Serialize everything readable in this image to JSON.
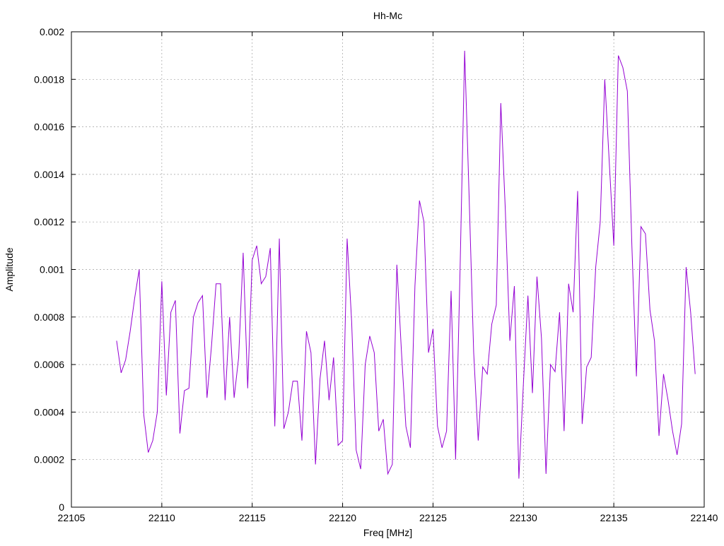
{
  "chart_data": {
    "type": "line",
    "title": "Hh-Mc",
    "xlabel": "Freq [MHz]",
    "ylabel": "Amplitude",
    "xlim": [
      22105,
      22140
    ],
    "ylim": [
      0,
      0.002
    ],
    "grid": true,
    "x_ticks": [
      "22105",
      "22110",
      "22115",
      "22120",
      "22125",
      "22130",
      "22135",
      "22140"
    ],
    "y_ticks": [
      "0",
      "0.0002",
      "0.0004",
      "0.0006",
      "0.0008",
      "0.001",
      "0.0012",
      "0.0014",
      "0.0016",
      "0.0018",
      "0.002"
    ],
    "line_color": "#9400d3",
    "series": [
      {
        "x_start": 22107.5,
        "x_step": 0.25,
        "values": [
          0.0007,
          0.000565,
          0.00062,
          0.00074,
          0.00088,
          0.001,
          0.00039,
          0.00023,
          0.00028,
          0.0004,
          0.00095,
          0.00047,
          0.00082,
          0.00087,
          0.00031,
          0.00049,
          0.0005,
          0.0008,
          0.00086,
          0.00089,
          0.00046,
          0.00068,
          0.00094,
          0.00094,
          0.00045,
          0.0008,
          0.00046,
          0.00063,
          0.00107,
          0.0005,
          0.00104,
          0.0011,
          0.00094,
          0.00097,
          0.00109,
          0.00034,
          0.00113,
          0.00033,
          0.0004,
          0.00053,
          0.00053,
          0.00028,
          0.00074,
          0.00065,
          0.00018,
          0.00054,
          0.0007,
          0.00045,
          0.00063,
          0.00026,
          0.00028,
          0.00113,
          0.00078,
          0.00024,
          0.00016,
          0.0006,
          0.00072,
          0.00065,
          0.00032,
          0.00037,
          0.00014,
          0.00018,
          0.00102,
          0.00066,
          0.00034,
          0.00025,
          0.00093,
          0.00129,
          0.0012,
          0.00065,
          0.00075,
          0.00034,
          0.00025,
          0.00032,
          0.00091,
          0.0002,
          0.00101,
          0.00192,
          0.0013,
          0.00065,
          0.00028,
          0.00059,
          0.00056,
          0.00077,
          0.00085,
          0.0017,
          0.00125,
          0.0007,
          0.00093,
          0.00012,
          0.00052,
          0.00089,
          0.00048,
          0.00097,
          0.00071,
          0.00014,
          0.0006,
          0.00057,
          0.00082,
          0.00032,
          0.00094,
          0.00082,
          0.00133,
          0.00035,
          0.00059,
          0.00063,
          0.00101,
          0.0012,
          0.0018,
          0.00145,
          0.0011,
          0.0019,
          0.00185,
          0.00175,
          0.0011,
          0.00055,
          0.00118,
          0.00115,
          0.00083,
          0.0007,
          0.0003,
          0.00056,
          0.00045,
          0.00032,
          0.00022,
          0.00035,
          0.00101,
          0.00082,
          0.00056
        ]
      }
    ]
  }
}
